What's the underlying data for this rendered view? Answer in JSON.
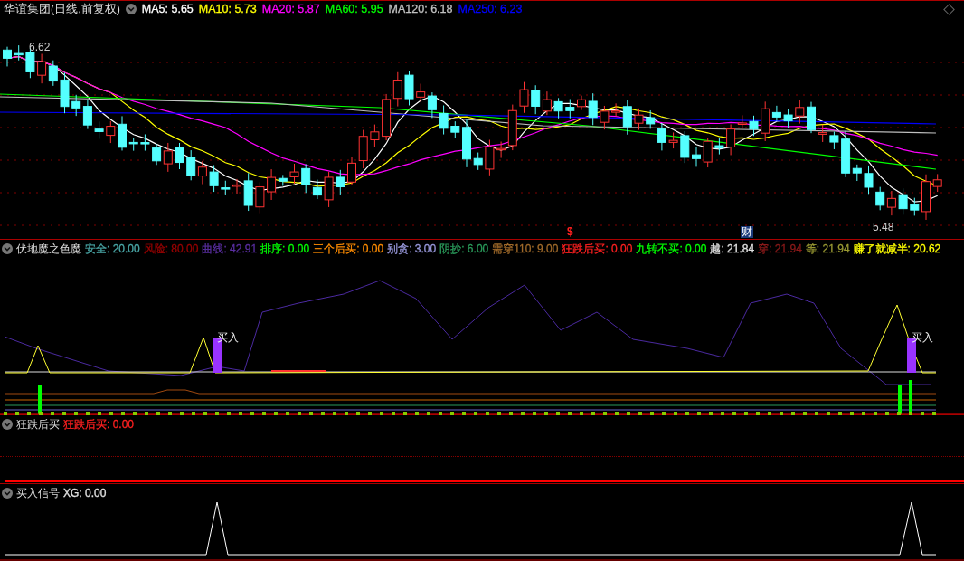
{
  "main_panel": {
    "title": "华谊集团(日线,前复权)",
    "indicators": [
      {
        "label": "MA5: 5.65",
        "color": "#ffffff"
      },
      {
        "label": "MA10: 5.73",
        "color": "#ffff00"
      },
      {
        "label": "MA20: 5.87",
        "color": "#ff00ff"
      },
      {
        "label": "MA60: 5.95",
        "color": "#00ff00"
      },
      {
        "label": "MA120: 6.18",
        "color": "#c0c0c0"
      },
      {
        "label": "MA250: 6.23",
        "color": "#0000ff"
      }
    ],
    "high_label": "6.62",
    "low_label": "5.48",
    "markers": [
      {
        "text": "$",
        "kind": "signal"
      },
      {
        "text": "财",
        "kind": "finance"
      }
    ]
  },
  "indicator_panel": {
    "title": "伏地魔之色魔",
    "indicators": [
      {
        "label": "安全: 20.00",
        "color": "#4aa8a8"
      },
      {
        "label": "风险: 80.00",
        "color": "#990000"
      },
      {
        "label": "曲线: 42.91",
        "color": "#5a2ea0"
      },
      {
        "label": "排序: 0.00",
        "color": "#00ff00"
      },
      {
        "label": "三个后买: 0.00",
        "color": "#ff8c00"
      },
      {
        "label": "别贪: 3.00",
        "color": "#9999dd"
      },
      {
        "label": "阴抄: 6.00",
        "color": "#2a9a5a"
      },
      {
        "label": "需穿110: 9.00",
        "color": "#a06a2a"
      },
      {
        "label": "狂跌后买: 0.00",
        "color": "#ff2020"
      },
      {
        "label": "九转不买: 0.00",
        "color": "#00ff00"
      },
      {
        "label": "越: 21.84",
        "color": "#e0e0e0"
      },
      {
        "label": "穿: 21.94",
        "color": "#8b1a1a"
      },
      {
        "label": "等: 21.94",
        "color": "#999933"
      },
      {
        "label": "赚了就减半: 20.62",
        "color": "#ffff00"
      }
    ],
    "signal_labels": [
      "买入",
      "买入"
    ]
  },
  "crash_panel": {
    "title": "狂跌后买",
    "indicators": [
      {
        "label": "狂跌后买: 0.00",
        "color": "#ff2020"
      }
    ]
  },
  "signal_panel": {
    "title": "买入信号",
    "indicators": [
      {
        "label": "XG: 0.00",
        "color": "#e0e0e0"
      }
    ]
  }
}
